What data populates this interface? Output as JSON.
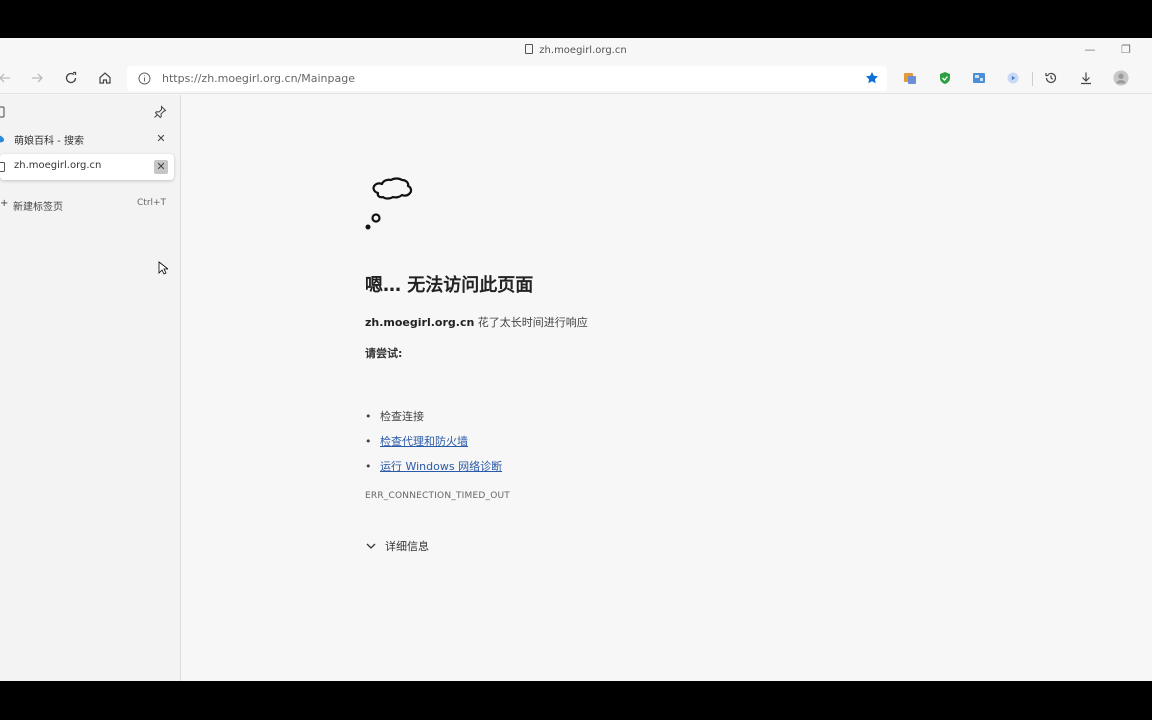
{
  "window": {
    "title": "zh.moegirl.org.cn",
    "minimize_label": "—",
    "restore_label": "❐"
  },
  "toolbar": {
    "address": "https://zh.moegirl.org.cn/Mainpage",
    "accent_color": "#0a6fd6"
  },
  "sidebar": {
    "tabs": [
      {
        "title": "萌娘百科 - 搜索",
        "close_label": "✕",
        "active": false
      },
      {
        "title": "zh.moegirl.org.cn",
        "close_label": "✕",
        "active": true
      }
    ],
    "new_tab": {
      "plus": "+",
      "label": "新建标签页",
      "shortcut": "Ctrl+T"
    }
  },
  "error_page": {
    "title": "嗯… 无法访问此页面",
    "host": "zh.moegirl.org.cn",
    "desc": "花了太长时间进行响应",
    "try_title": "请尝试:",
    "suggestions": [
      {
        "bullet": "•",
        "text": "检查连接",
        "link": false
      },
      {
        "bullet": "•",
        "text": "检查代理和防火墙",
        "link": true
      },
      {
        "bullet": "•",
        "text": "运行 Windows 网络诊断",
        "link": true
      }
    ],
    "code": "ERR_CONNECTION_TIMED_OUT",
    "details_label": "详细信息"
  }
}
